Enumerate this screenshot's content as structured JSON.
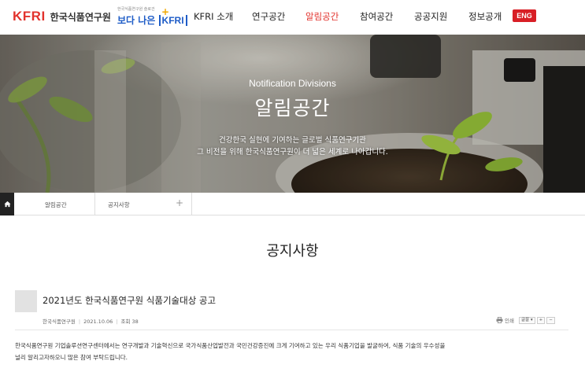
{
  "header": {
    "logo": "KFRI",
    "org_name": "한국식품연구원",
    "slogan_small": "한국식품연구원 슬로건",
    "slogan_main": "보다 나은",
    "slogan_kfri": "KFRI",
    "slogan_plus": "+",
    "eng_label": "ENG"
  },
  "nav": {
    "items": [
      {
        "label": "KFRI 소개"
      },
      {
        "label": "연구공간"
      },
      {
        "label": "알림공간"
      },
      {
        "label": "참여공간"
      },
      {
        "label": "공공지원"
      },
      {
        "label": "정보공개"
      }
    ],
    "active_index": 2
  },
  "hero": {
    "subtitle": "Notification Divisions",
    "title": "알림공간",
    "desc_line1": "건강한국 실현에 기여하는 글로벌 식품연구기관",
    "desc_line2": "그 비전을 위해 한국식품연구원이 더 넓은 세계로 나아갑니다."
  },
  "breadcrumb": {
    "level1": "알림공간",
    "level2": "공지사항",
    "expand": "+"
  },
  "page_title": "공지사항",
  "post": {
    "title": "2021년도 한국식품연구원 식품기술대상 공고",
    "author": "한국식품연구원",
    "date": "2021.10.06",
    "views": "조회 38",
    "print_label": "인쇄",
    "font_label": "글꼴",
    "zoom_in": "+",
    "zoom_out": "−",
    "body_line1": "한국식품연구원 기업솔루션연구센터에서는 연구개발과 기술혁신으로 국가식품산업발전과 국민건강증진에 크게 기여하고 있는 우리 식품기업을 발굴하여, 식품 기술의 우수성을",
    "body_line2": "널리 알리고자하오니 많은 참여 부탁드립니다."
  },
  "colors": {
    "brand_red": "#e2322c",
    "slogan_blue": "#1e5cc7",
    "eng_bg": "#d81f26",
    "home_bg": "#222222"
  }
}
